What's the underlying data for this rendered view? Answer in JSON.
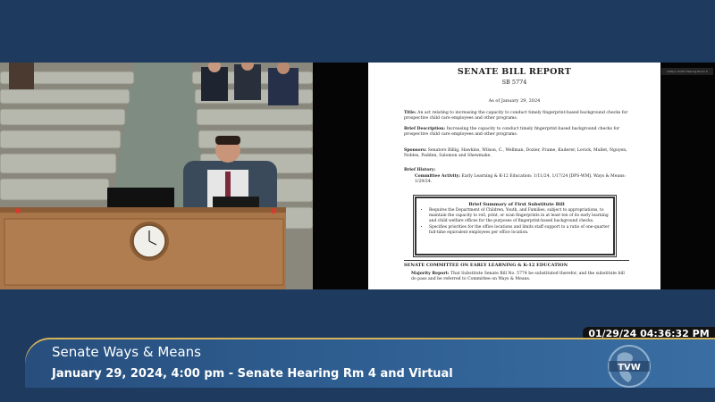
{
  "document": {
    "title": "SENATE BILL REPORT",
    "bill": "SB 5774",
    "as_of": "As of January 29, 2024",
    "title_label": "Title:",
    "title_text": "An act relating to increasing the capacity to conduct timely fingerprint-based background checks for prospective child care employees and other programs.",
    "brief_desc_label": "Brief Description:",
    "brief_desc_text": "Increasing the capacity to conduct timely fingerprint-based background checks for prospective child care employees and other programs.",
    "sponsors_label": "Sponsors:",
    "sponsors_text": "Senators Billig, Hawkins, Wilson, C., Wellman, Dozier, Frame, Kuderer, Lovick, Mullet, Nguyen, Nobles, Padden, Salomon and Shewmake.",
    "history_label": "Brief History:",
    "committee_label": "Committee Activity:",
    "committee_text": "Early Learning & K-12 Education: 1/11/24, 1/17/24 [DPS-WM]. Ways & Means: 1/29/24.",
    "summary_title": "Brief Summary of First Substitute Bill",
    "summary_items": [
      "Requires the Department of Children, Youth, and Families, subject to appropriations, to maintain the capacity to roll, print, or scan fingerprints in at least ten of its early learning and child welfare offices for the purposes of fingerprint-based background checks.",
      "Specifies priorities for the office locations and limits staff support to a ratio of one-quarter full-time equivalent employees per office location."
    ],
    "committee_section": "SENATE COMMITTEE ON EARLY LEARNING & K-12 EDUCATION",
    "majority_label": "Majority Report:",
    "majority_text": "That Substitute Senate Bill No. 5774 be substituted therefor, and the substitute bill do pass and be referred to Committee on Ways & Means."
  },
  "doc_thumb_label": "Caitlyn Smith Hearing Room 4",
  "timestamp": "01/29/24 04:36:32 PM",
  "lower_third": {
    "line1": "Senate Ways & Means",
    "line2": "January 29, 2024, 4:00 pm - Senate Hearing Rm 4 and Virtual"
  },
  "logo_text": "TVW",
  "colors": {
    "background": "#1e3b5f",
    "banner": "#2f5f92",
    "accent_gold": "#d4b35a"
  }
}
